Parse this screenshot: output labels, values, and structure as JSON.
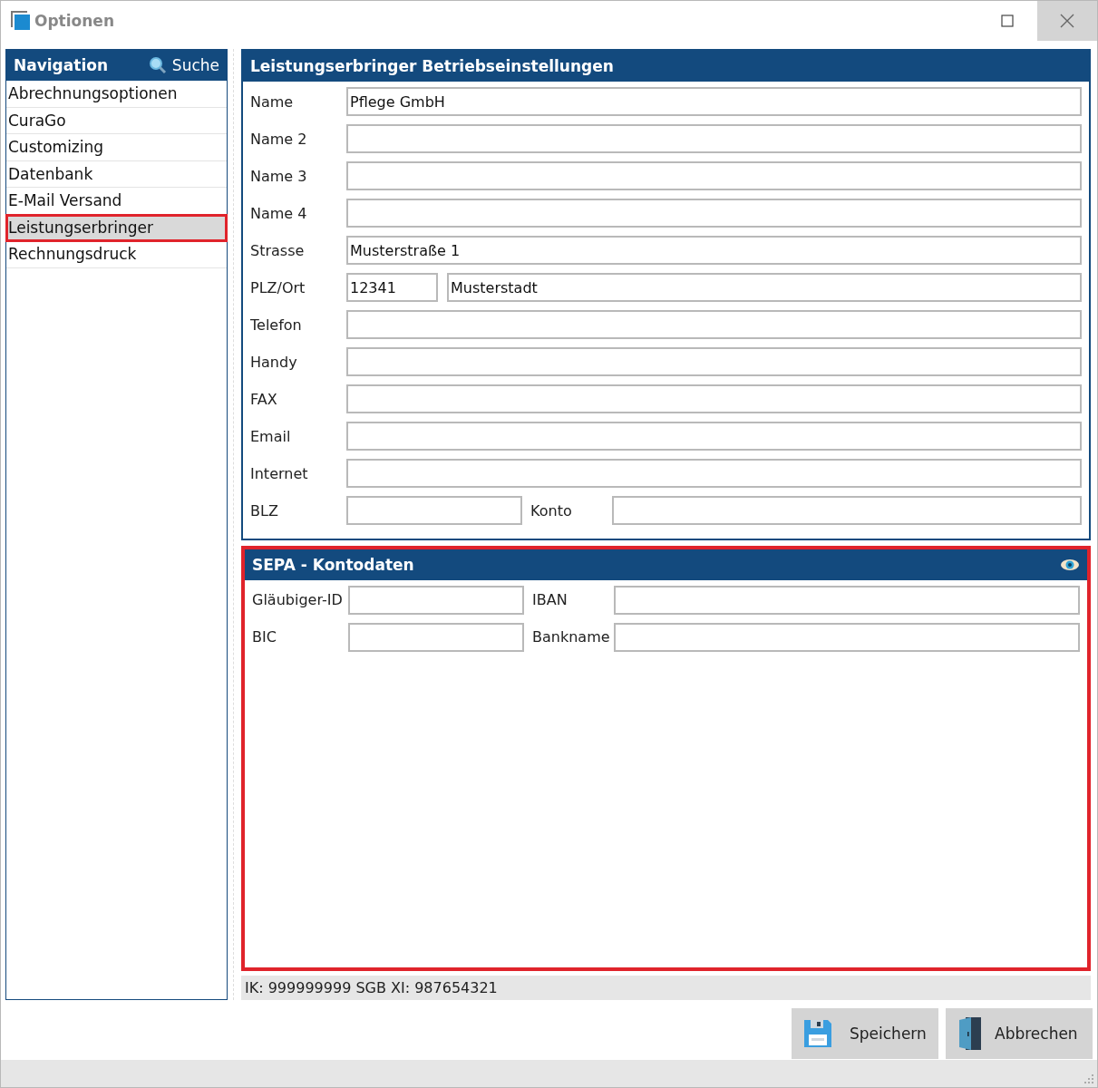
{
  "window": {
    "title": "Optionen"
  },
  "navigation": {
    "title": "Navigation",
    "search_label": "Suche",
    "items": [
      {
        "label": "Abrechnungsoptionen",
        "selected": false,
        "highlighted": false
      },
      {
        "label": "CuraGo",
        "selected": false,
        "highlighted": false
      },
      {
        "label": "Customizing",
        "selected": false,
        "highlighted": false
      },
      {
        "label": "Datenbank",
        "selected": false,
        "highlighted": false
      },
      {
        "label": "E-Mail Versand",
        "selected": false,
        "highlighted": false
      },
      {
        "label": "Leistungserbringer",
        "selected": true,
        "highlighted": true
      },
      {
        "label": "Rechnungsdruck",
        "selected": false,
        "highlighted": false
      }
    ]
  },
  "settings_section": {
    "title": "Leistungserbringer Betriebseinstellungen",
    "highlighted": false,
    "rows": [
      {
        "kind": "single",
        "label": "Name",
        "value": "Pflege GmbH"
      },
      {
        "kind": "single",
        "label": "Name 2"
      },
      {
        "kind": "single",
        "label": "Name 3"
      },
      {
        "kind": "single",
        "label": "Name 4"
      },
      {
        "kind": "single",
        "label": "Strasse",
        "value": "Musterstraße 1"
      },
      {
        "kind": "pair",
        "label": "PLZ/Ort",
        "values": [
          "12341",
          "Musterstadt"
        ]
      },
      {
        "kind": "single",
        "label": "Telefon"
      },
      {
        "kind": "single",
        "label": "Handy"
      },
      {
        "kind": "single",
        "label": "FAX"
      },
      {
        "kind": "single",
        "label": "Email"
      },
      {
        "kind": "single",
        "label": "Internet"
      },
      {
        "kind": "split",
        "label": "BLZ",
        "second_label": "Konto"
      }
    ]
  },
  "sepa_section": {
    "title": "SEPA - Kontodaten",
    "highlighted": true,
    "rows": [
      {
        "kind": "split",
        "label": "Gläubiger-ID",
        "second_label": "IBAN"
      },
      {
        "kind": "split",
        "label": "BIC",
        "second_label": "Bankname"
      }
    ]
  },
  "status_bar": {
    "text": "IK: 999999999 SGB XI: 987654321"
  },
  "buttons": [
    {
      "kind": "save",
      "label": "Speichern"
    },
    {
      "kind": "cancel",
      "label": "Abbrechen"
    }
  ]
}
